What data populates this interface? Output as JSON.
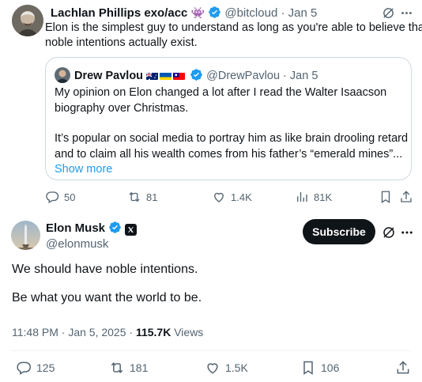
{
  "first_tweet": {
    "author_name": "Lachlan Phillips exo/acc",
    "author_emoji": "👾",
    "handle": "@bitcloud",
    "date": "Jan 5",
    "text_line1": "Elon is the simplest guy to understand as long as you're able to believe that",
    "text_line2": "noble intentions actually exist.",
    "quote": {
      "author_name": "Drew Pavlou",
      "handle": "@DrewPavlou",
      "date": "Jan 5",
      "line1": "My opinion on Elon changed a lot after I read the Walter Isaacson",
      "line2": "biography over Christmas.",
      "line3": "It’s popular on social media to portray him as like brain drooling retard",
      "line4": "and to claim all his wealth comes from his father’s “emerald mines”...",
      "show_more": "Show more"
    },
    "actions": {
      "replies": "50",
      "reposts": "81",
      "likes": "1.4K",
      "views": "81K"
    }
  },
  "main_tweet": {
    "author_name": "Elon Musk",
    "handle": "@elonmusk",
    "subscribe_label": "Subscribe",
    "text_line1": "We should have noble intentions.",
    "text_line2": "Be what you want the world to be.",
    "timestamp": "11:48 PM · Jan 5, 2025 · ",
    "views_count": "115.7K",
    "views_label": " Views",
    "actions": {
      "replies": "125",
      "reposts": "181",
      "likes": "1.5K",
      "bookmarks": "106"
    }
  },
  "colors": {
    "text": "#0f1419",
    "muted": "#536471",
    "link": "#1d9bf0",
    "border": "#cfd9de",
    "verified": "#1d9bf0"
  }
}
